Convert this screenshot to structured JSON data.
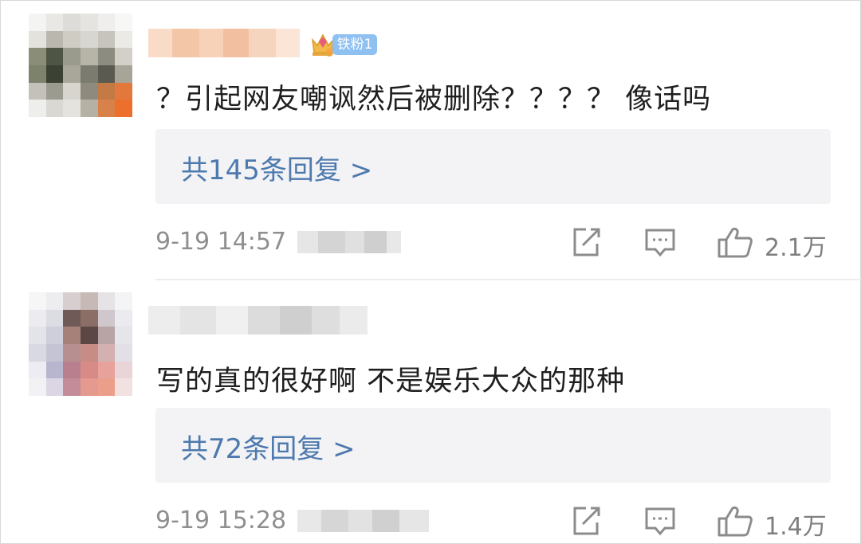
{
  "comments": [
    {
      "badge": {
        "label": "铁粉1"
      },
      "content": "？引起网友嘲讽然后被删除？？？？ 像话吗",
      "replies_label": "共145条回复 >",
      "time": "9-19 14:57",
      "likes": "2.1万",
      "icons": {
        "crown": "fan-crown-icon",
        "share": "share-icon",
        "reply": "comment-icon",
        "like": "thumbs-up-icon"
      }
    },
    {
      "content": "写的真的很好啊 不是娱乐大众的那种",
      "replies_label": "共72条回复 >",
      "time": "9-19 15:28",
      "likes": "1.4万",
      "icons": {
        "share": "share-icon",
        "reply": "comment-icon",
        "like": "thumbs-up-icon"
      }
    }
  ],
  "colors": {
    "reply_link": "#4d79ad",
    "reply_box_bg": "#f3f3f6",
    "badge_bg": "#8ec0f2",
    "meta_text": "#8f8f8f",
    "icon": "#8c8c8c"
  }
}
